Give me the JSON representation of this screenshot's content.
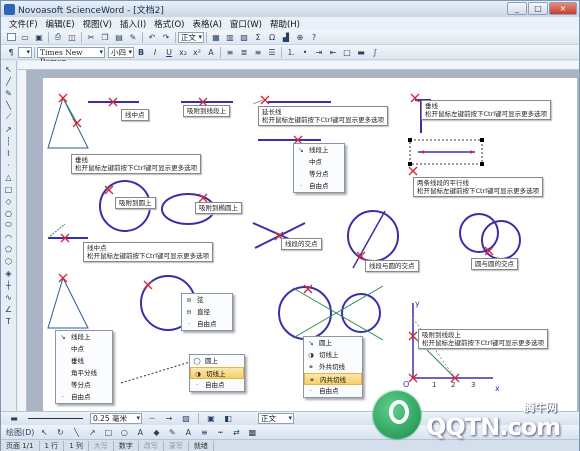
{
  "window": {
    "title": "Novoasoft ScienceWord - [文档2]",
    "buttons": [
      "_",
      "□",
      "×"
    ]
  },
  "menu": [
    "文件(F)",
    "编辑(E)",
    "视图(V)",
    "插入(I)",
    "格式(O)",
    "表格(A)",
    "窗口(W)",
    "帮助(H)"
  ],
  "toolbar": {
    "style_combo": "正文",
    "font_combo": "Times New Roman",
    "size_combo": "小四",
    "bold": "B",
    "italic": "I",
    "underline": "U"
  },
  "tooltips": {
    "t1": "线中点",
    "t2": "吸附到线段上",
    "t3a": "延长线",
    "t3b": "松开鼠标左键前按下Ctrl键可显示更多选项",
    "t4a": "垂线",
    "t4b": "松开鼠标左键前按下Ctrl键可显示更多选项",
    "t5a": "垂线",
    "t5b": "松开鼠标左键前按下Ctrl键可显示更多选项",
    "t6a": "两条线段的平行线",
    "t6b": "松开鼠标左键前按下Ctrl键可显示更多选项",
    "t7": "吸附到圆上",
    "t8": "吸附到椭圆上",
    "t9a": "线中点",
    "t9b": "松开鼠标左键前按下Ctrl键可显示更多选项",
    "t10": "线段的交点",
    "t11": "线段与圆的交点",
    "t12": "圆与圆的交点",
    "t13a": "吸附到线段上",
    "t13b": "松开鼠标左键前按下Ctrl键可显示更多选项"
  },
  "menus": {
    "m1": [
      "线段上",
      "中点",
      "等分点",
      "自由点"
    ],
    "m2": [
      "弦",
      "直径",
      "自由点"
    ],
    "m3": [
      "线段上",
      "中点",
      "垂线",
      "角平分线",
      "等分点",
      "自由点"
    ],
    "m4": [
      "圆上",
      "切线上",
      "自由点"
    ],
    "m5": [
      "圆上",
      "切线上",
      "外共切线",
      "内共切线",
      "自由点"
    ]
  },
  "axis_labels": {
    "y": "y",
    "x": "x",
    "o": "O",
    "n1": "1",
    "n2": "2",
    "n3": "3"
  },
  "bottom": {
    "line_width": "0.25 毫米",
    "style": "正文",
    "draw_label": "绘图(D)"
  },
  "status": {
    "page": "页面 1/1",
    "row": "1 行",
    "col": "1 列",
    "cap": "大写",
    "num": "数字",
    "ovr": "改写",
    "rec": "录写",
    "ready": "就绪"
  },
  "watermark": {
    "text": "QQTN.com",
    "brand": "腾牛网"
  },
  "colors": {
    "accent_line": "#3d2ea8",
    "marker": "#d6283a",
    "construct": "#2e8a59",
    "highlight": "#f5cf6b"
  }
}
